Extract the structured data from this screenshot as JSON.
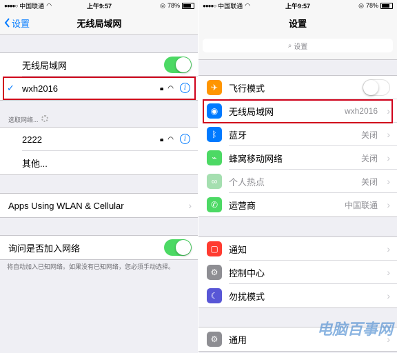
{
  "left": {
    "status": {
      "carrier": "中国联通",
      "time": "上午9:57",
      "battery": "78%"
    },
    "nav": {
      "back_label": "设置",
      "title": "无线局域网"
    },
    "wlan_row": {
      "label": "无线局域网",
      "enabled": true
    },
    "connected": {
      "name": "wxh2016",
      "check": "✓",
      "info": "i"
    },
    "choose_label": "选取网络...",
    "networks": [
      {
        "name": "2222"
      },
      {
        "name": "其他..."
      }
    ],
    "apps_row": {
      "label": "Apps Using WLAN & Cellular"
    },
    "ask_row": {
      "label": "询问是否加入网络",
      "enabled": true
    },
    "ask_note": "将自动加入已知网络。如果没有已知网络，您必须手动选择。"
  },
  "right": {
    "status": {
      "carrier": "中国联通",
      "time": "上午9:57",
      "battery": "78%"
    },
    "nav": {
      "title": "设置"
    },
    "search": {
      "placeholder": "设置"
    },
    "rows": [
      {
        "label": "飞行模式",
        "icon": "airplane-icon",
        "glyph": "✈",
        "color": "#ff9500",
        "toggle": false
      },
      {
        "label": "无线局域网",
        "icon": "wifi-icon",
        "glyph": "◉",
        "color": "#007aff",
        "value": "wxh2016"
      },
      {
        "label": "蓝牙",
        "icon": "bluetooth-icon",
        "glyph": "ᛒ",
        "color": "#007aff",
        "value": "关闭"
      },
      {
        "label": "蜂窝移动网络",
        "icon": "cellular-icon",
        "glyph": "⌁",
        "color": "#4cd964",
        "value": "关闭"
      },
      {
        "label": "个人热点",
        "icon": "hotspot-icon",
        "glyph": "∞",
        "color": "#a5dfb0",
        "value": "关闭",
        "dimmed": true
      },
      {
        "label": "运营商",
        "icon": "phone-icon",
        "glyph": "✆",
        "color": "#4cd964",
        "value": "中国联通"
      }
    ],
    "rows2": [
      {
        "label": "通知",
        "icon": "notification-icon",
        "glyph": "▢",
        "color": "#ff3b30"
      },
      {
        "label": "控制中心",
        "icon": "control-center-icon",
        "glyph": "⚙",
        "color": "#8e8e93"
      },
      {
        "label": "勿扰模式",
        "icon": "moon-icon",
        "glyph": "☾",
        "color": "#5856d6"
      }
    ],
    "rows3": [
      {
        "label": "通用",
        "icon": "gear-icon",
        "glyph": "⚙",
        "color": "#8e8e93"
      }
    ],
    "watermark": "电脑百事网"
  }
}
